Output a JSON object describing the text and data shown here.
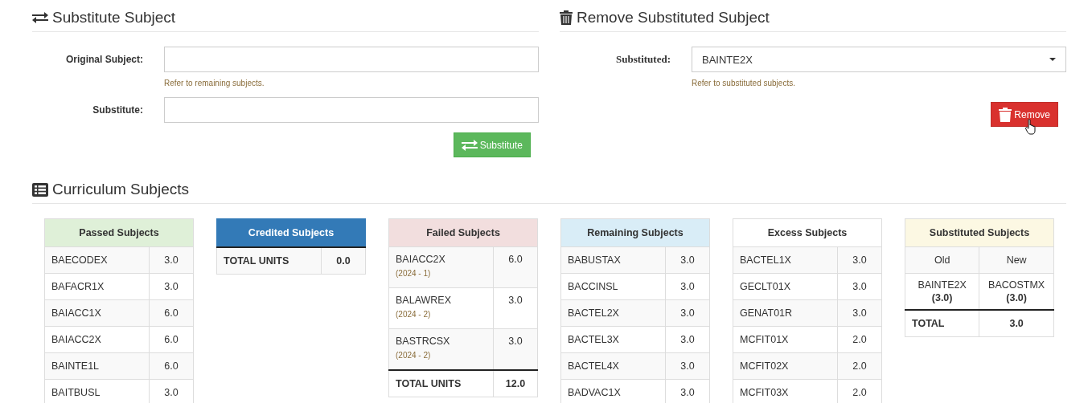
{
  "substitute": {
    "title": "Substitute Subject",
    "fields": [
      {
        "label": "Original Subject:",
        "help": "Refer to remaining subjects."
      },
      {
        "label": "Substitute:"
      }
    ],
    "button": "Substitute"
  },
  "remove": {
    "title": "Remove Substituted Subject",
    "field": {
      "label": "Substituted:",
      "value": "BAINTE2X",
      "help": "Refer to substituted subjects."
    },
    "button": "Remove"
  },
  "curriculum": {
    "title": "Curriculum Subjects",
    "tables": [
      {
        "title": "Passed Subjects",
        "color": "#dff0d8",
        "rows": [
          {
            "subject": "BAECODEX",
            "units": "3.0"
          },
          {
            "subject": "BAFACR1X",
            "units": "3.0"
          },
          {
            "subject": "BAIACC1X",
            "units": "6.0"
          },
          {
            "subject": "BAIACC2X",
            "units": "6.0"
          },
          {
            "subject": "BAINTE1L",
            "units": "6.0"
          },
          {
            "subject": "BAITBUSL",
            "units": "3.0"
          }
        ]
      },
      {
        "title": "Credited Subjects",
        "color": "#337ab7",
        "total": {
          "label": "TOTAL UNITS",
          "value": "0.0"
        }
      },
      {
        "title": "Failed Subjects",
        "color": "#f2dede",
        "rows": [
          {
            "subject": "BAIACC2X",
            "term": "(2024 - 1)",
            "units": "6.0"
          },
          {
            "subject": "BALAWREX",
            "term": "(2024 - 2)",
            "units": "3.0"
          },
          {
            "subject": "BASTRCSX",
            "term": "(2024 - 2)",
            "units": "3.0"
          }
        ],
        "total": {
          "label": "TOTAL UNITS",
          "value": "12.0"
        }
      },
      {
        "title": "Remaining Subjects",
        "color": "#d9edf7",
        "rows": [
          {
            "subject": "BABUSTAX",
            "units": "3.0"
          },
          {
            "subject": "BACCINSL",
            "units": "3.0"
          },
          {
            "subject": "BACTEL2X",
            "units": "3.0"
          },
          {
            "subject": "BACTEL3X",
            "units": "3.0"
          },
          {
            "subject": "BACTEL4X",
            "units": "3.0"
          },
          {
            "subject": "BADVAC1X",
            "units": "3.0"
          }
        ]
      },
      {
        "title": "Excess Subjects",
        "color": "#ffffff",
        "rows": [
          {
            "subject": "BACTEL1X",
            "units": "3.0"
          },
          {
            "subject": "GECLT01X",
            "units": "3.0"
          },
          {
            "subject": "GENAT01R",
            "units": "3.0"
          },
          {
            "subject": "MCFIT01X",
            "units": "2.0"
          },
          {
            "subject": "MCFIT02X",
            "units": "2.0"
          },
          {
            "subject": "MCFIT03X",
            "units": "2.0"
          }
        ]
      },
      {
        "title": "Substituted Subjects",
        "color": "#fcf8e3",
        "columns": [
          "Old",
          "New"
        ],
        "pairs": [
          {
            "old": "BAINTE2X\n**(3.0)**",
            "new": "BACOSTMX\n**(3.0)**"
          }
        ],
        "total": {
          "label": "TOTAL",
          "value": "3.0"
        }
      }
    ]
  }
}
